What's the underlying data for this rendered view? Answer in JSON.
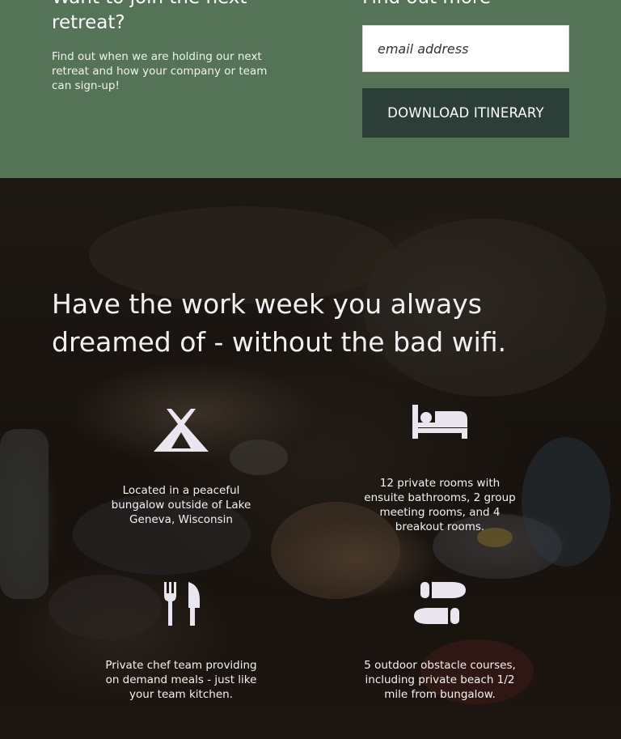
{
  "signup": {
    "title": "Want to join the next retreat?",
    "description": "Find out when we are holding our next retreat and how your company or team can sign-up!",
    "findout_title": "Find out more",
    "email_placeholder": "email address",
    "download_label": "DOWNLOAD ITINERARY"
  },
  "hero": {
    "headline": "Have the work week you always dreamed of - without the bad wifi.",
    "features": [
      {
        "icon": "tent-icon",
        "text": "Located in a peaceful bungalow outside of Lake Geneva, Wisconsin"
      },
      {
        "icon": "bed-icon",
        "text": "12 private rooms with ensuite bathrooms, 2 group meeting rooms, and 4 breakout rooms."
      },
      {
        "icon": "utensils-icon",
        "text": "Private chef team providing on demand meals - just like your team kitchen."
      },
      {
        "icon": "shoe-prints-icon",
        "text": "5 outdoor obstacle courses, including private beach 1/2 mile from bungalow."
      }
    ]
  },
  "colors": {
    "signup_background": "#557356",
    "button_background": "#2b3e37",
    "icon_color": "#eae6f0"
  }
}
